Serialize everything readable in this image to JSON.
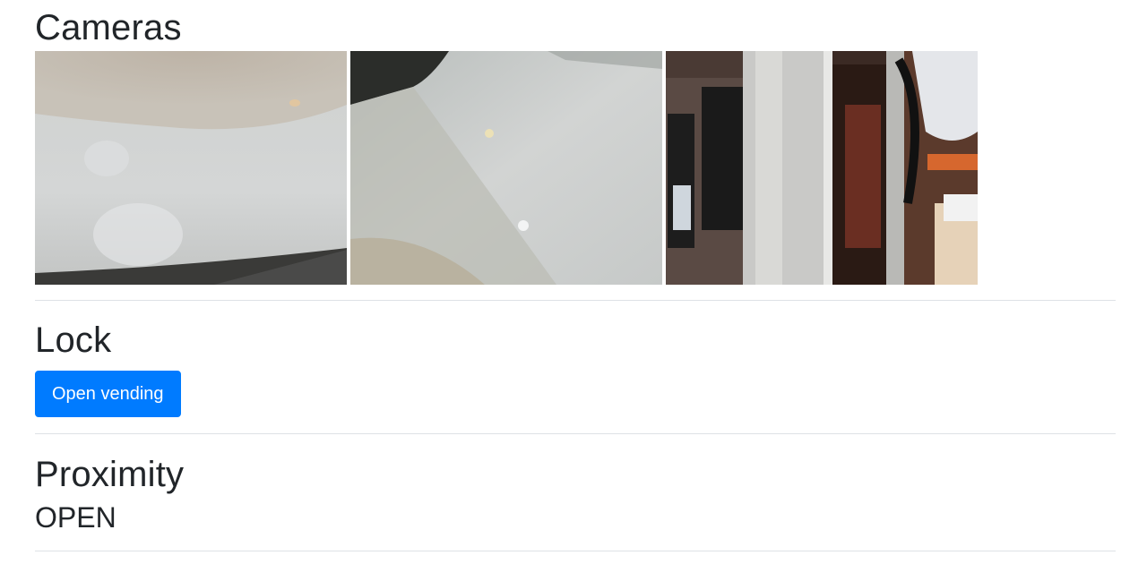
{
  "cameras": {
    "heading": "Cameras",
    "feeds": [
      {
        "icon": "camera-feed-1"
      },
      {
        "icon": "camera-feed-2"
      },
      {
        "icon": "camera-feed-3"
      }
    ]
  },
  "lock": {
    "heading": "Lock",
    "button_label": "Open vending",
    "button_color": "#007bff"
  },
  "proximity": {
    "heading": "Proximity",
    "value": "OPEN"
  }
}
